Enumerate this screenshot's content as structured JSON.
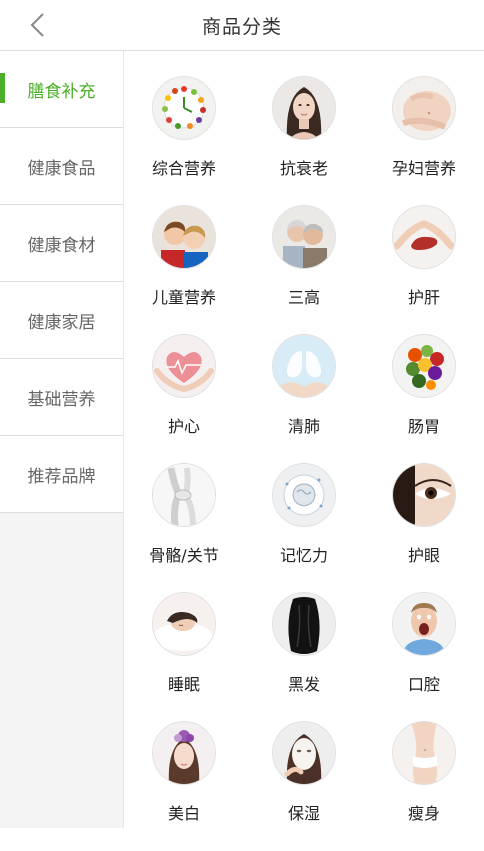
{
  "header": {
    "title": "商品分类",
    "back_icon": "chevron-left-icon"
  },
  "colors": {
    "accent": "#4caf2a",
    "sidebar_bg": "#f4f4f4",
    "divider": "#dddddd"
  },
  "sidebar": {
    "items": [
      {
        "label": "膳食补充",
        "active": true
      },
      {
        "label": "健康食品",
        "active": false
      },
      {
        "label": "健康食材",
        "active": false
      },
      {
        "label": "健康家居",
        "active": false
      },
      {
        "label": "基础营养",
        "active": false
      },
      {
        "label": "推荐品牌",
        "active": false
      }
    ]
  },
  "categories": [
    {
      "label": "综合营养",
      "icon": "fruit-clock-icon"
    },
    {
      "label": "抗衰老",
      "icon": "woman-face-icon"
    },
    {
      "label": "孕妇营养",
      "icon": "pregnant-belly-icon"
    },
    {
      "label": "儿童营养",
      "icon": "children-icon"
    },
    {
      "label": "三高",
      "icon": "elderly-couple-icon"
    },
    {
      "label": "护肝",
      "icon": "liver-hands-icon"
    },
    {
      "label": "护心",
      "icon": "heart-hands-icon"
    },
    {
      "label": "清肺",
      "icon": "lungs-icon"
    },
    {
      "label": "肠胃",
      "icon": "vegetables-icon"
    },
    {
      "label": "骨骼/关节",
      "icon": "knee-joint-icon"
    },
    {
      "label": "记忆力",
      "icon": "brain-icon"
    },
    {
      "label": "护眼",
      "icon": "eye-icon"
    },
    {
      "label": "睡眠",
      "icon": "sleeping-woman-icon"
    },
    {
      "label": "黑发",
      "icon": "black-hair-icon"
    },
    {
      "label": "口腔",
      "icon": "open-mouth-man-icon"
    },
    {
      "label": "美白",
      "icon": "flower-woman-icon"
    },
    {
      "label": "保湿",
      "icon": "face-mask-icon"
    },
    {
      "label": "瘦身",
      "icon": "slim-waist-icon"
    }
  ]
}
